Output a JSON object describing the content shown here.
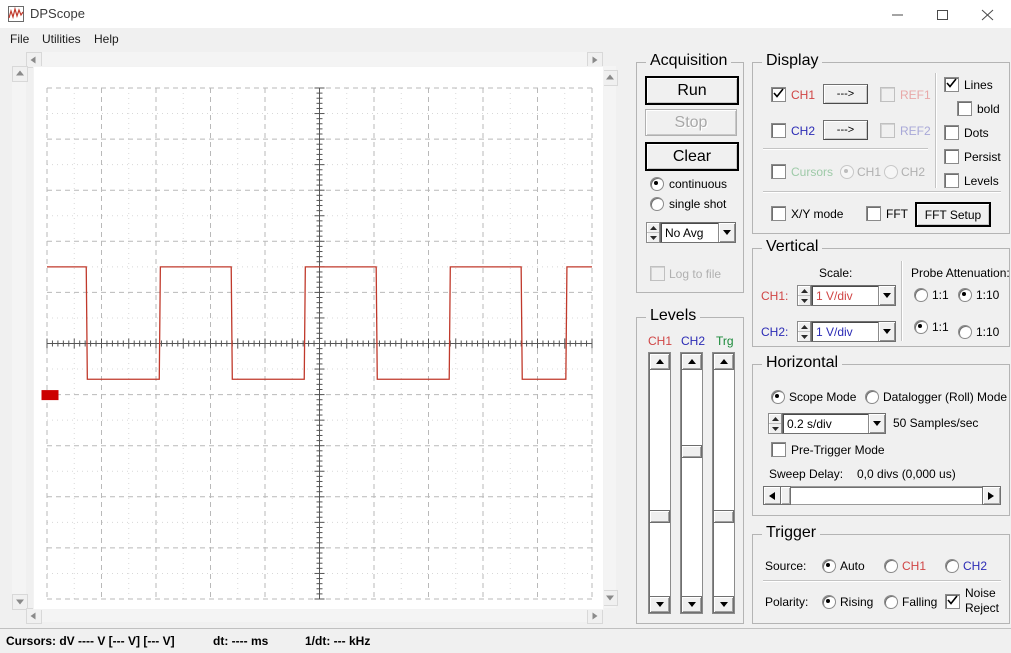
{
  "window": {
    "title": "DPScope",
    "icon": "app-waveform-icon",
    "minimize": "minimize-icon",
    "maximize": "maximize-icon",
    "close": "close-icon"
  },
  "menu": {
    "items": [
      {
        "label": "File"
      },
      {
        "label": "Utilities"
      },
      {
        "label": "Help"
      }
    ]
  },
  "chart_data": {
    "type": "line",
    "title": "",
    "xlabel": "",
    "ylabel": "",
    "grid": true,
    "legend": "none",
    "divisions_x": 10,
    "divisions_y": 10,
    "timebase": "0.2 s/div",
    "vertical_scale": "1 V/div",
    "trace_color": "#c0392b",
    "grid_color": "#b9b9b9",
    "background": "#ffffff",
    "series": [
      {
        "name": "CH1",
        "color": "#c0392b",
        "waveform": "square",
        "high_level_div": 1.5,
        "low_level_div": -0.7,
        "points": [
          [
            0.0,
            1.5
          ],
          [
            0.72,
            1.5
          ],
          [
            0.74,
            -0.7
          ],
          [
            2.06,
            -0.7
          ],
          [
            2.08,
            1.5
          ],
          [
            3.38,
            1.5
          ],
          [
            3.4,
            -0.7
          ],
          [
            4.72,
            -0.7
          ],
          [
            4.74,
            1.5
          ],
          [
            6.04,
            1.5
          ],
          [
            6.06,
            -0.7
          ],
          [
            7.38,
            -0.7
          ],
          [
            7.4,
            1.5
          ],
          [
            8.7,
            1.5
          ],
          [
            8.72,
            -0.7
          ],
          [
            9.52,
            -0.7
          ],
          [
            9.54,
            1.5
          ],
          [
            10.0,
            1.5
          ]
        ]
      }
    ],
    "trigger_marker": {
      "position_div": 0.0,
      "level_div": -1.0,
      "color": "#cc0000"
    },
    "center_axis": true
  },
  "acquisition": {
    "title": "Acquisition",
    "run_label": "Run",
    "stop_label": "Stop",
    "clear_label": "Clear",
    "mode_continuous": "continuous",
    "mode_single": "single shot",
    "mode_selected": "continuous",
    "avg_value": "No Avg",
    "log_to_file": "Log to file",
    "log_to_file_checked": false
  },
  "display": {
    "title": "Display",
    "ch1": "CH1",
    "ch2": "CH2",
    "ref1": "REF1",
    "ref2": "REF2",
    "arrow_label": "--->",
    "cursors": "Cursors",
    "cursors_ch1": "CH1",
    "cursors_ch2": "CH2",
    "xy_mode": "X/Y mode",
    "fft": "FFT",
    "fft_setup": "FFT Setup",
    "lines": "Lines",
    "bold": "bold",
    "dots": "Dots",
    "persist": "Persist",
    "levels": "Levels",
    "ch1_checked": true,
    "ch2_checked": false,
    "lines_checked": true,
    "bold_checked": false,
    "dots_checked": false,
    "persist_checked": false,
    "levels_checked": false
  },
  "vertical": {
    "title": "Vertical",
    "scale_header": "Scale:",
    "probe_header": "Probe Attenuation:",
    "ch1": "CH1:",
    "ch2": "CH2:",
    "ch1_scale": "1 V/div",
    "ch2_scale": "1 V/div",
    "att_1_1": "1:1",
    "att_1_10": "1:10",
    "ch1_attenuation": "1:10",
    "ch2_attenuation": "1:1"
  },
  "horizontal": {
    "title": "Horizontal",
    "scope_mode": "Scope Mode",
    "datalogger_mode": "Datalogger (Roll) Mode",
    "mode_selected": "Scope Mode",
    "timebase": "0.2 s/div",
    "sample_rate": "50 Samples/sec",
    "pre_trigger": "Pre-Trigger Mode",
    "pre_trigger_checked": false,
    "sweep_delay_label": "Sweep Delay:",
    "sweep_delay_value": "0,0 divs (0,000 us)"
  },
  "trigger": {
    "title": "Trigger",
    "source_label": "Source:",
    "source_auto": "Auto",
    "source_ch1": "CH1",
    "source_ch2": "CH2",
    "source_selected": "Auto",
    "polarity_label": "Polarity:",
    "polarity_rising": "Rising",
    "polarity_falling": "Falling",
    "polarity_selected": "Rising",
    "noise_reject_line1": "Noise",
    "noise_reject_line2": "Reject",
    "noise_reject_checked": true
  },
  "levels": {
    "title": "Levels",
    "ch1": "CH1",
    "ch2": "CH2",
    "trg": "Trg",
    "ch1_thumb_pct": 62,
    "ch2_thumb_pct": 33,
    "trg_thumb_pct": 62
  },
  "status": {
    "cursors": "Cursors: dV ---- V  [--- V] [--- V]",
    "dt": "dt: ---- ms",
    "invdt": "1/dt: --- kHz"
  },
  "colors": {
    "ch1": "#d04545",
    "ch2": "#2b2bb5",
    "trg": "#1a8a3a",
    "trace": "#c0392b",
    "panel": "#f0f0f0"
  }
}
